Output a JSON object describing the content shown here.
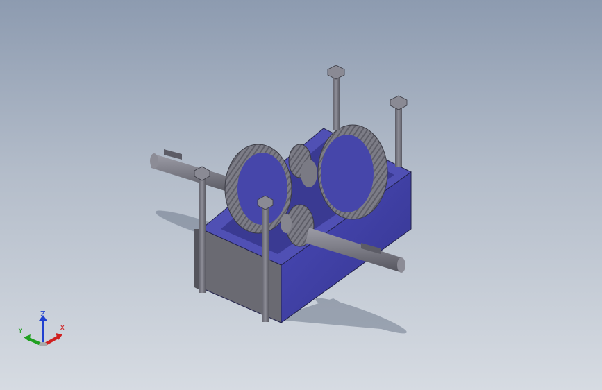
{
  "viewport": {
    "background_top": "#8d9bb0",
    "background_bottom": "#d6dbe2"
  },
  "model": {
    "part_color_blue": "#4040a0",
    "part_color_grey": "#6e6e78",
    "gear_color": "#7f7f8a"
  },
  "triad": {
    "x_label": "X",
    "y_label": "Y",
    "z_label": "Z",
    "x_color": "#d02020",
    "y_color": "#20a020",
    "z_color": "#2040d0"
  }
}
